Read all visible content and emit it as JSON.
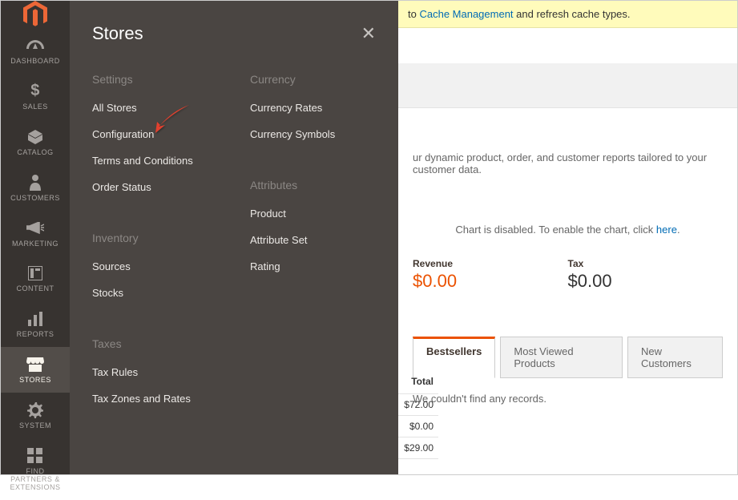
{
  "mainnav": {
    "items": [
      {
        "label": "DASHBOARD",
        "icon": "dashboard-icon"
      },
      {
        "label": "SALES",
        "icon": "dollar-icon"
      },
      {
        "label": "CATALOG",
        "icon": "box-icon"
      },
      {
        "label": "CUSTOMERS",
        "icon": "person-icon"
      },
      {
        "label": "MARKETING",
        "icon": "megaphone-icon"
      },
      {
        "label": "CONTENT",
        "icon": "layout-icon"
      },
      {
        "label": "REPORTS",
        "icon": "bars-icon"
      },
      {
        "label": "STORES",
        "icon": "storefront-icon"
      },
      {
        "label": "SYSTEM",
        "icon": "gear-icon"
      },
      {
        "label": "FIND PARTNERS & EXTENSIONS",
        "icon": "blocks-icon"
      }
    ]
  },
  "flyout": {
    "title": "Stores",
    "columns": [
      {
        "groups": [
          {
            "title": "Settings",
            "links": [
              "All Stores",
              "Configuration",
              "Terms and Conditions",
              "Order Status"
            ]
          },
          {
            "title": "Inventory",
            "links": [
              "Sources",
              "Stocks"
            ]
          },
          {
            "title": "Taxes",
            "links": [
              "Tax Rules",
              "Tax Zones and Rates"
            ]
          }
        ]
      },
      {
        "groups": [
          {
            "title": "Currency",
            "links": [
              "Currency Rates",
              "Currency Symbols"
            ]
          },
          {
            "title": "Attributes",
            "links": [
              "Product",
              "Attribute Set",
              "Rating"
            ]
          }
        ]
      }
    ]
  },
  "content": {
    "notice_prefix": "to ",
    "notice_link": "Cache Management",
    "notice_suffix": " and refresh cache types.",
    "desc": "ur dynamic product, order, and customer reports tailored to your customer data.",
    "chartnote_prefix": "Chart is disabled. To enable the chart, click ",
    "chartnote_link": "here",
    "chartnote_suffix": ".",
    "stats": [
      {
        "label": "Revenue",
        "value": "$0.00",
        "color": "orange"
      },
      {
        "label": "Tax",
        "value": "$0.00",
        "color": "orange"
      }
    ],
    "tabs": [
      {
        "label": "Bestsellers",
        "active": true
      },
      {
        "label": "Most Viewed Products",
        "active": false
      },
      {
        "label": "New Customers",
        "active": false
      }
    ],
    "norecords": "We couldn't find any records."
  },
  "peek": {
    "header": "Total",
    "rows": [
      "$72.00",
      "$0.00",
      "$29.00"
    ]
  }
}
